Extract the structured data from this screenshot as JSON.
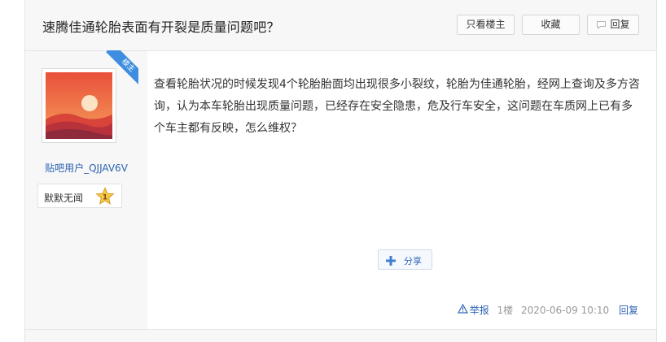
{
  "thread": {
    "title": "速腾佳通轮胎表面有开裂是质量问题吧？",
    "buttons": {
      "only_op": "只看楼主",
      "favorite": "收藏",
      "reply": "回复"
    }
  },
  "author": {
    "badge": "楼主",
    "username": "贴吧用户_QJJAV6V",
    "level_name": "默默无闻",
    "level_number": "1"
  },
  "post": {
    "content": "查看轮胎状况的时候发现4个轮胎胎面均出现很多小裂纹，轮胎为佳通轮胎，经网上查询及多方咨询，认为本车轮胎出现质量问题，已经存在安全隐患，危及行车安全，这问题在车质网上已有多个车主都有反映，怎么维权？",
    "share_label": "分享",
    "report_label": "举报",
    "floor": "1楼",
    "timestamp": "2020-06-09 10:10",
    "reply_label": "回复"
  },
  "colors": {
    "link": "#2d64b3",
    "badge": "#3f8de0",
    "header_bg": "#f7f7f7"
  },
  "icons": {
    "reply": "speech-bubble-icon",
    "share": "plus-icon",
    "report": "warning-triangle-icon",
    "level": "star-icon"
  }
}
